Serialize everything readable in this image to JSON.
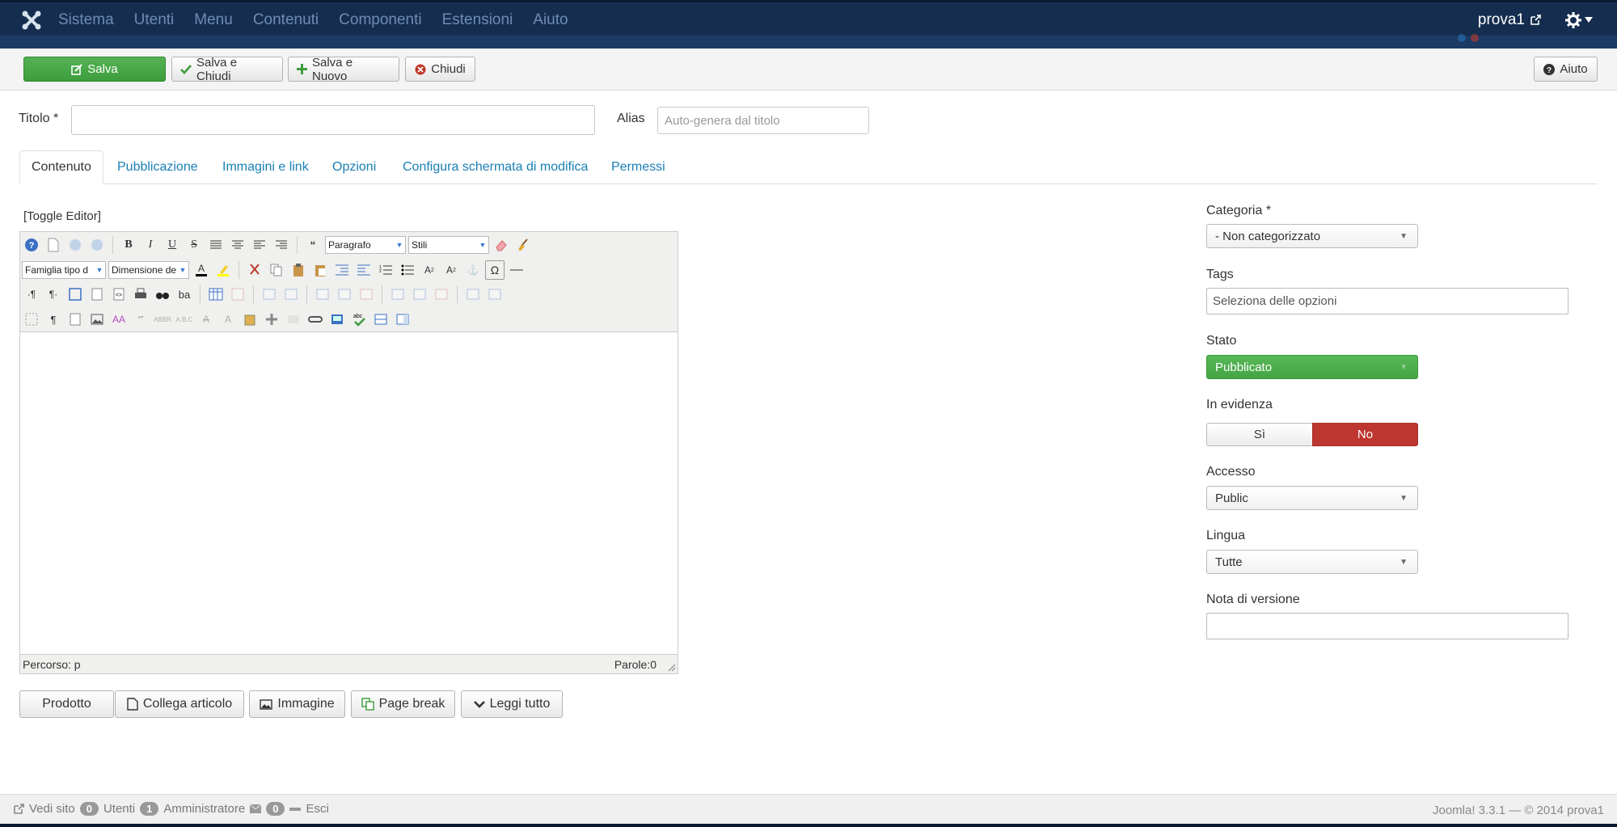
{
  "navbar": {
    "menu": [
      "Sistema",
      "Utenti",
      "Menu",
      "Contenuti",
      "Componenti",
      "Estensioni",
      "Aiuto"
    ],
    "user": "prova1"
  },
  "toolbar": {
    "save": "Salva",
    "save_close": "Salva e Chiudi",
    "save_new": "Salva e Nuovo",
    "close": "Chiudi",
    "help": "Aiuto"
  },
  "form": {
    "title_label": "Titolo *",
    "title_value": "",
    "alias_label": "Alias",
    "alias_placeholder": "Auto-genera dal titolo"
  },
  "tabs": [
    "Contenuto",
    "Pubblicazione",
    "Immagini e link",
    "Opzioni",
    "Configura schermata di modifica",
    "Permessi"
  ],
  "editor": {
    "toggle": "[Toggle Editor]",
    "format_select": "Paragrafo",
    "styles_select": "Stili",
    "font_family_select": "Famiglia tipo d",
    "font_size_select": "Dimensione de",
    "path": "Percorso: p",
    "words": "Parole:0"
  },
  "editor_buttons": {
    "prodotto": "Prodotto",
    "collega": "Collega articolo",
    "immagine": "Immagine",
    "pagebreak": "Page break",
    "leggi": "Leggi tutto"
  },
  "sidebar": {
    "categoria_label": "Categoria *",
    "categoria_value": "- Non categorizzato",
    "tags_label": "Tags",
    "tags_placeholder": "Seleziona delle opzioni",
    "stato_label": "Stato",
    "stato_value": "Pubblicato",
    "evidenza_label": "In evidenza",
    "evidenza_yes": "Sì",
    "evidenza_no": "No",
    "accesso_label": "Accesso",
    "accesso_value": "Public",
    "lingua_label": "Lingua",
    "lingua_value": "Tutte",
    "nota_label": "Nota di versione",
    "nota_value": ""
  },
  "footer": {
    "vedi_sito": "Vedi sito",
    "utenti_count": "0",
    "utenti": "Utenti",
    "admin_count": "1",
    "admin": "Amministratore",
    "msg_count": "0",
    "esci": "Esci",
    "version": "Joomla! 3.3.1 — © 2014 prova1"
  },
  "colors": {
    "navbar": "#152e4f",
    "save_green": "#46a546",
    "no_red": "#bd362f",
    "link_blue": "#1a7fb5"
  }
}
